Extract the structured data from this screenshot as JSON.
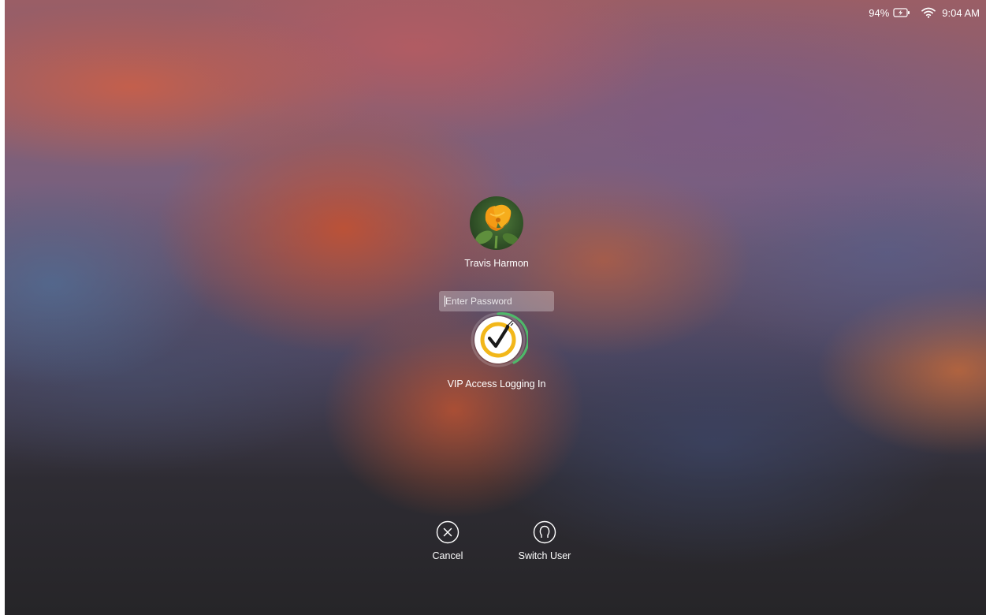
{
  "status_bar": {
    "battery_percent": "94%",
    "time": "9:04 AM",
    "icons": [
      "battery-charging-icon",
      "wifi-icon"
    ]
  },
  "login": {
    "user_name": "Travis Harmon",
    "avatar_icon": "orange-poppy-flower-avatar",
    "password_placeholder": "Enter Password",
    "plugin_status": "VIP Access Logging In",
    "plugin_icon": "vip-access-checkmark-icon",
    "progress_color": "#4fb86a",
    "accent_color": "#f2b71a"
  },
  "actions": {
    "cancel_label": "Cancel",
    "cancel_icon": "close-circle-icon",
    "switch_user_label": "Switch User",
    "switch_user_icon": "user-circle-icon"
  }
}
